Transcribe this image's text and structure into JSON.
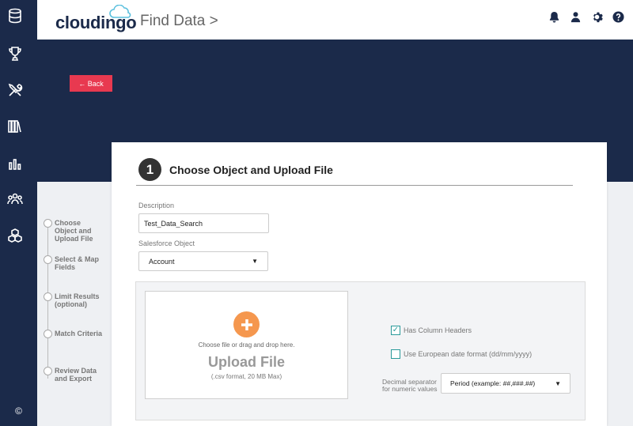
{
  "app": {
    "logo_text": "cloudingo"
  },
  "header": {
    "breadcrumb": "Find Data  >"
  },
  "rail": {
    "copyright": "©"
  },
  "back_button": {
    "label": "← Back"
  },
  "steps": [
    {
      "label": "Choose Object and Upload File"
    },
    {
      "label": "Select & Map Fields"
    },
    {
      "label": "Limit Results (optional)"
    },
    {
      "label": "Match Criteria"
    },
    {
      "label": "Review Data and Export"
    }
  ],
  "card": {
    "step_number": "1",
    "title": "Choose Object and Upload File",
    "description_label": "Description",
    "description_value": "Test_Data_Search",
    "object_label": "Salesforce Object",
    "object_value": "Account"
  },
  "upload": {
    "hint": "Choose file or drag and drop here.",
    "title": "Upload File",
    "subtitle": "(.csv format, 20 MB Max)"
  },
  "options": {
    "has_headers_label": "Has Column Headers",
    "has_headers_checked": true,
    "european_date_label": "Use European date format (dd/mm/yyyy)",
    "european_date_checked": false,
    "decimal_label": "Decimal separator for numeric values",
    "decimal_value": "Period (example: ##,###.##)"
  },
  "colors": {
    "navy": "#1b2a4a",
    "back_red": "#e83950",
    "upload_orange": "#f5974e",
    "check_teal": "#2a9a9a"
  }
}
